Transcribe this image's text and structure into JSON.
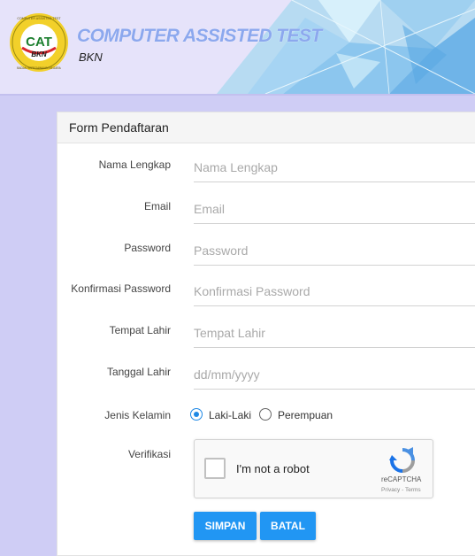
{
  "header": {
    "title": "COMPUTER ASSISTED TEST",
    "subtitle": "BKN",
    "logo": {
      "main": "CAT",
      "sub": "BKN",
      "arc_top": "COMPUTER ASSISTED TEST",
      "arc_bottom": "BADAN KEPEGAWAIAN NEGARA"
    }
  },
  "form": {
    "heading": "Form Pendaftaran",
    "fields": [
      {
        "label": "Nama Lengkap",
        "placeholder": "Nama Lengkap"
      },
      {
        "label": "Email",
        "placeholder": "Email"
      },
      {
        "label": "Password",
        "placeholder": "Password"
      },
      {
        "label": "Konfirmasi Password",
        "placeholder": "Konfirmasi Password"
      },
      {
        "label": "Tempat Lahir",
        "placeholder": "Tempat Lahir"
      },
      {
        "label": "Tanggal Lahir",
        "placeholder": "dd/mm/yyyy"
      }
    ],
    "gender": {
      "label": "Jenis Kelamin",
      "options": [
        "Laki-Laki",
        "Perempuan"
      ],
      "selected": "Laki-Laki"
    },
    "verification": {
      "label": "Verifikasi",
      "checkbox_text": "I'm not a robot",
      "brand": "reCAPTCHA",
      "links": "Privacy - Terms"
    },
    "buttons": {
      "save": "SIMPAN",
      "cancel": "BATAL"
    }
  },
  "colors": {
    "accent": "#2196f3",
    "title": "#8ca8ee",
    "background": "#cfcdf5"
  }
}
